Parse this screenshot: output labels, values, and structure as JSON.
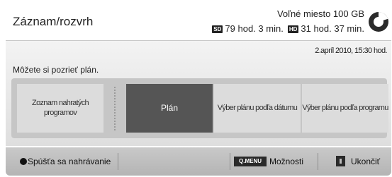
{
  "header": {
    "title": "Záznam/rozvrh",
    "free_space_label": "Voľné miesto 100 GB",
    "sd_badge": "SD",
    "sd_time": "79 hod. 3 min.",
    "hd_badge": "HD",
    "hd_time": "31 hod. 37 min.",
    "disk_icon": "disk-usage-icon"
  },
  "panel": {
    "datetime": "2.apríl 2010, 15:30 hod.",
    "info_text": "Môžete si pozrieť plán."
  },
  "menu": {
    "items": [
      {
        "label": "Zoznam nahratých programov",
        "selected": false
      },
      {
        "label": "Plán",
        "selected": true
      },
      {
        "label": "Výber plánu podľa dátumu",
        "selected": false
      },
      {
        "label": "Výber plánu podľa programu",
        "selected": false
      }
    ]
  },
  "footer": {
    "record_label": "Spúšťa sa nahrávanie",
    "menu_button": "Q.MENU",
    "options_label": "Možnosti",
    "exit_label": "Ukončiť"
  },
  "colors": {
    "selected_item": "#555555",
    "item_background": "#dcdcdc",
    "tray": "#c6c6c6",
    "footer": "#bdbdbd"
  }
}
